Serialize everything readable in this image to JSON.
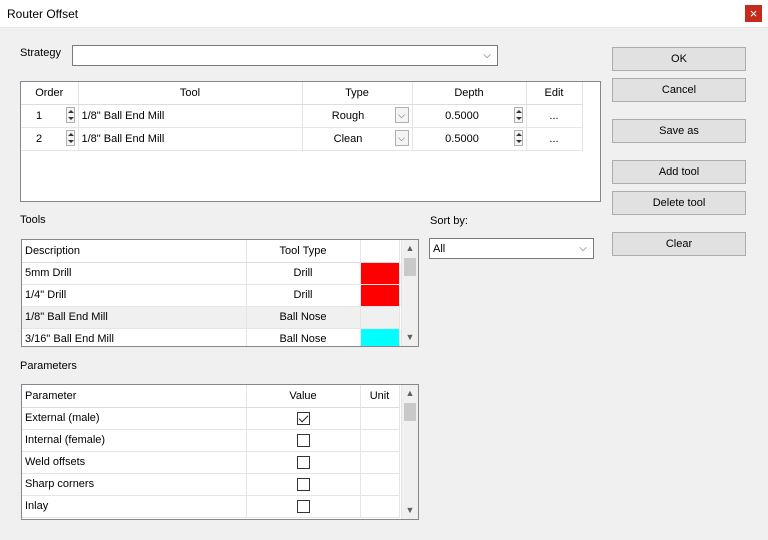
{
  "window": {
    "title": "Router Offset",
    "close_glyph": "×"
  },
  "strategy": {
    "label": "Strategy",
    "value": ""
  },
  "operations": {
    "columns": [
      "Order",
      "Tool",
      "Type",
      "Depth",
      "Edit"
    ],
    "rows": [
      {
        "order": "1",
        "tool": "1/8\" Ball End Mill",
        "type": "Rough",
        "depth": "0.5000",
        "edit": "..."
      },
      {
        "order": "2",
        "tool": "1/8\" Ball End Mill",
        "type": "Clean",
        "depth": "0.5000",
        "edit": "..."
      }
    ]
  },
  "buttons": {
    "ok": "OK",
    "cancel": "Cancel",
    "save_as": "Save as",
    "add_tool": "Add tool",
    "delete_tool": "Delete tool",
    "clear": "Clear"
  },
  "tools": {
    "label": "Tools",
    "columns": [
      "Description",
      "Tool Type",
      ""
    ],
    "rows": [
      {
        "description": "5mm Drill",
        "tool_type": "Drill",
        "color": "#ff0000"
      },
      {
        "description": "1/4\" Drill",
        "tool_type": "Drill",
        "color": "#ff0000"
      },
      {
        "description": "1/8\" Ball End Mill",
        "tool_type": "Ball Nose",
        "color": "#f0f0f0"
      },
      {
        "description": "3/16\" Ball End Mill",
        "tool_type": "Ball Nose",
        "color": "#00ffff"
      }
    ]
  },
  "sort": {
    "label": "Sort by:",
    "value": "All"
  },
  "parameters": {
    "label": "Parameters",
    "columns": [
      "Parameter",
      "Value",
      "Unit"
    ],
    "rows": [
      {
        "name": "External (male)",
        "checked": true,
        "unit": ""
      },
      {
        "name": "Internal (female)",
        "checked": false,
        "unit": ""
      },
      {
        "name": "Weld offsets",
        "checked": false,
        "unit": ""
      },
      {
        "name": "Sharp corners",
        "checked": false,
        "unit": ""
      },
      {
        "name": "Inlay",
        "checked": false,
        "unit": ""
      }
    ]
  },
  "icons": {
    "chevron_down": "⌵",
    "scroll_up": "▲",
    "scroll_down": "▼"
  }
}
